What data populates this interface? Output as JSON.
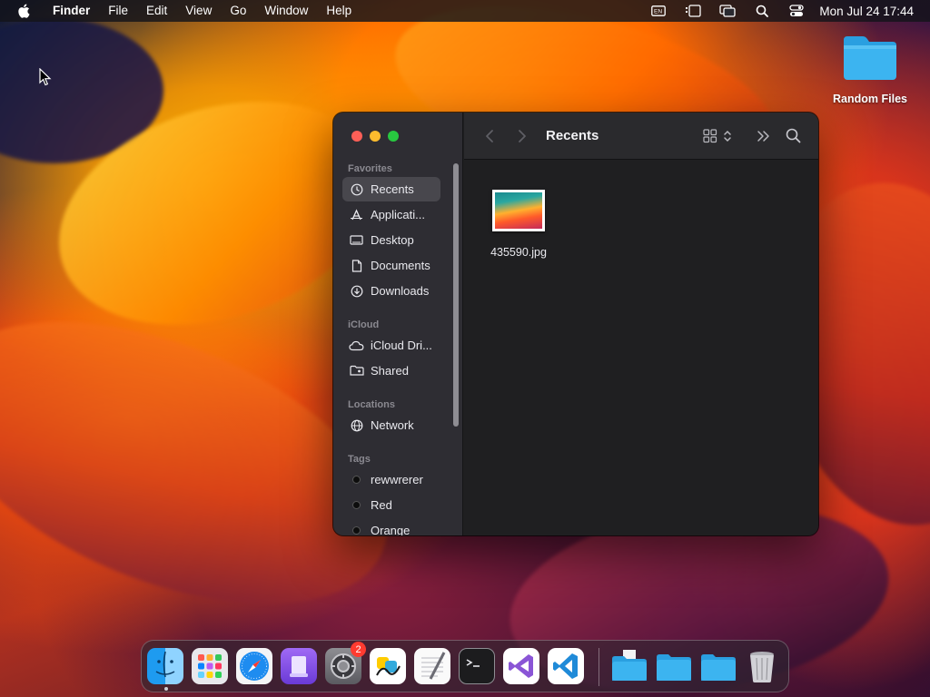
{
  "menubar": {
    "app_name": "Finder",
    "items": [
      "File",
      "Edit",
      "View",
      "Go",
      "Window",
      "Help"
    ],
    "clock": "Mon Jul 24  17:44"
  },
  "desktop": {
    "folder_label": "Random Files"
  },
  "finder": {
    "title": "Recents",
    "sidebar": {
      "favorites_header": "Favorites",
      "favorites": [
        {
          "label": "Recents",
          "icon": "clock-icon",
          "active": true
        },
        {
          "label": "Applicati...",
          "icon": "applications-icon"
        },
        {
          "label": "Desktop",
          "icon": "desktop-icon"
        },
        {
          "label": "Documents",
          "icon": "document-icon"
        },
        {
          "label": "Downloads",
          "icon": "download-icon"
        }
      ],
      "icloud_header": "iCloud",
      "icloud": [
        {
          "label": "iCloud Dri...",
          "icon": "cloud-icon"
        },
        {
          "label": "Shared",
          "icon": "shared-folder-icon"
        }
      ],
      "locations_header": "Locations",
      "locations": [
        {
          "label": "Network",
          "icon": "globe-icon"
        }
      ],
      "tags_header": "Tags",
      "tags": [
        {
          "label": "rewwrerer"
        },
        {
          "label": "Red"
        },
        {
          "label": "Orange"
        }
      ]
    },
    "files": [
      {
        "name": "435590.jpg"
      }
    ]
  },
  "dock": {
    "apps": [
      "Finder",
      "Launchpad",
      "Safari",
      "Apple Configurator",
      "System Settings",
      "Freeform",
      "TextEdit",
      "Terminal",
      "Visual Studio",
      "Visual Studio Code",
      "Downloads Stack",
      "Folder",
      "Folder",
      "Trash"
    ],
    "settings_badge": "2"
  },
  "colors": {
    "accent": "#0a84ff",
    "close": "#fe5f57",
    "minimize": "#febc2e",
    "zoom": "#28c840",
    "badge": "#ff3b30"
  }
}
